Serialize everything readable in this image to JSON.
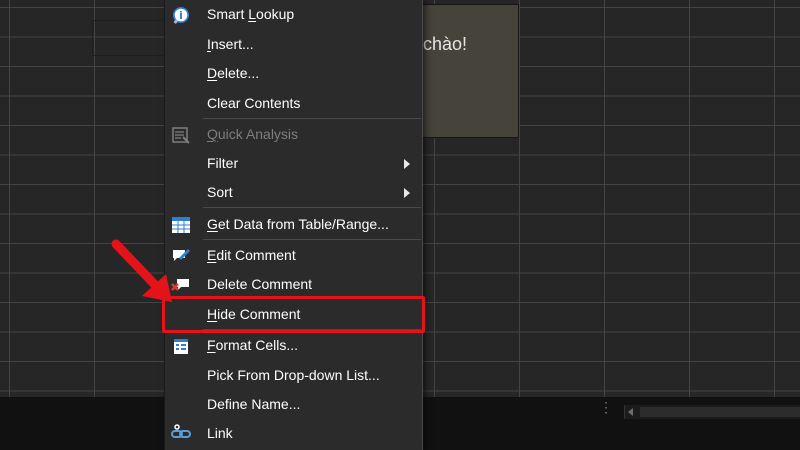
{
  "comment": {
    "text": "chào!"
  },
  "menu": {
    "items": [
      {
        "label": "Smart Lookup",
        "icon": "smart-lookup-icon",
        "key": "L"
      },
      {
        "label": "Insert...",
        "icon": "",
        "key": "I"
      },
      {
        "label": "Delete...",
        "icon": "",
        "key": "D"
      },
      {
        "label": "Clear Contents",
        "icon": "",
        "key": "N"
      },
      {
        "label": "Quick Analysis",
        "icon": "quick-analysis-icon",
        "key": "Q",
        "disabled": true
      },
      {
        "label": "Filter",
        "icon": "",
        "key": "E",
        "submenu": true
      },
      {
        "label": "Sort",
        "icon": "",
        "key": "O",
        "submenu": true
      },
      {
        "label": "Get Data from Table/Range...",
        "icon": "table-icon",
        "key": "G"
      },
      {
        "label": "Edit Comment",
        "icon": "edit-comment-icon",
        "key": "E"
      },
      {
        "label": "Delete Comment",
        "icon": "delete-comment-icon",
        "key": "M"
      },
      {
        "label": "Hide Comment",
        "icon": "",
        "key": "H",
        "highlighted": true
      },
      {
        "label": "Format Cells...",
        "icon": "format-cells-icon",
        "key": "F"
      },
      {
        "label": "Pick From Drop-down List...",
        "icon": "",
        "key": "K"
      },
      {
        "label": "Define Name...",
        "icon": "",
        "key": "A"
      },
      {
        "label": "Link",
        "icon": "link-icon",
        "key": "I"
      }
    ]
  },
  "colors": {
    "menu_background": "#2b2b2b",
    "highlight_border": "#e4131a",
    "annotation_arrow": "#e4131a",
    "comment_background": "#45433a"
  }
}
